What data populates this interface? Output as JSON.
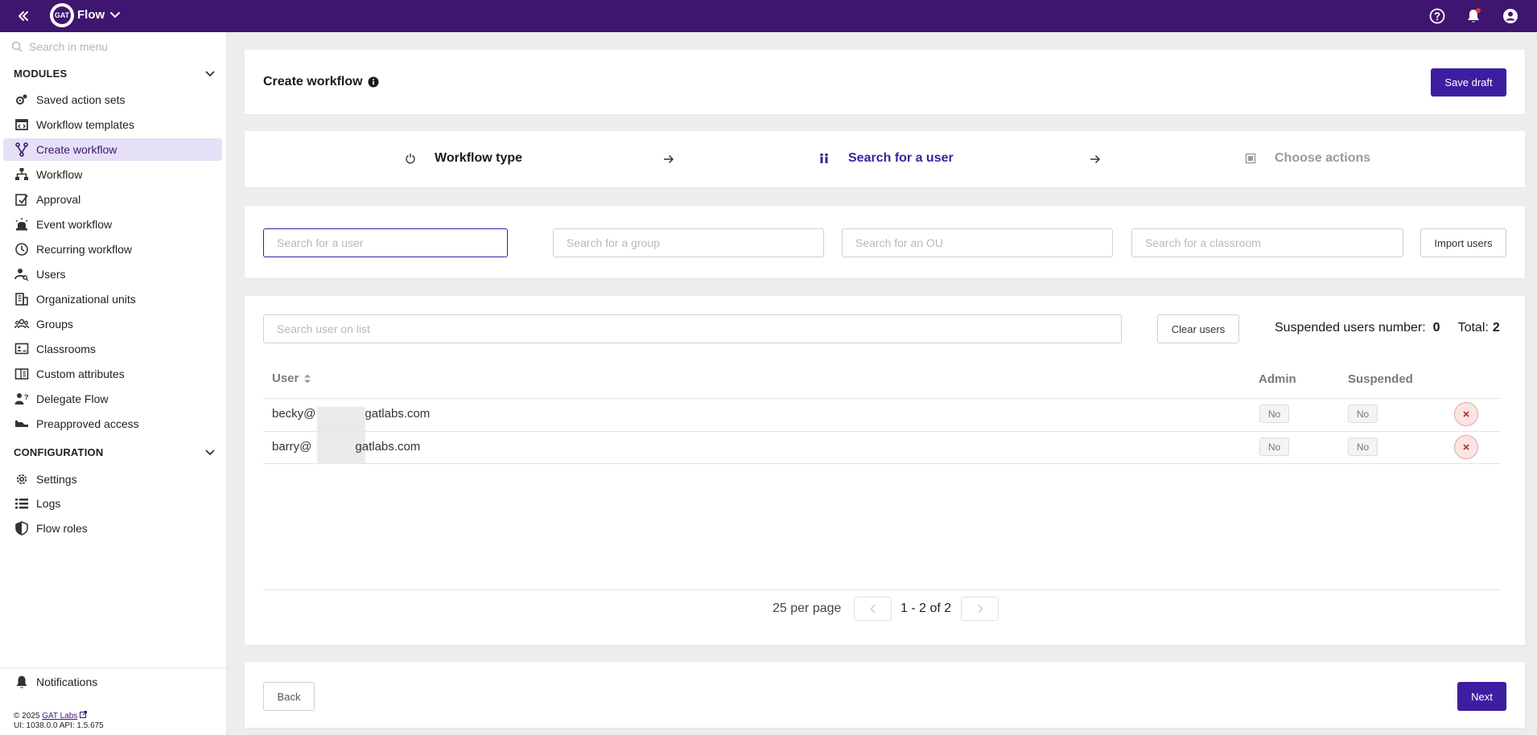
{
  "topbar": {
    "app_logo_text": "GAT",
    "app_name": "Flow"
  },
  "sidebar": {
    "search_placeholder": "Search in menu",
    "modules_title": "MODULES",
    "modules": [
      {
        "label": "Saved action sets",
        "icon": "gears-icon"
      },
      {
        "label": "Workflow templates",
        "icon": "template-icon"
      },
      {
        "label": "Create workflow",
        "icon": "fork-icon",
        "active": true
      },
      {
        "label": "Workflow",
        "icon": "hierarchy-icon"
      },
      {
        "label": "Approval",
        "icon": "approval-icon"
      },
      {
        "label": "Event workflow",
        "icon": "siren-icon"
      },
      {
        "label": "Recurring workflow",
        "icon": "clock-icon"
      },
      {
        "label": "Users",
        "icon": "user-search-icon"
      },
      {
        "label": "Organizational units",
        "icon": "building-icon"
      },
      {
        "label": "Groups",
        "icon": "groups-icon"
      },
      {
        "label": "Classrooms",
        "icon": "classroom-icon"
      },
      {
        "label": "Custom attributes",
        "icon": "attributes-icon"
      },
      {
        "label": "Delegate Flow",
        "icon": "delegate-icon"
      },
      {
        "label": "Preapproved access",
        "icon": "preapproved-icon"
      }
    ],
    "config_title": "CONFIGURATION",
    "config": [
      {
        "label": "Settings",
        "icon": "gear-icon"
      },
      {
        "label": "Logs",
        "icon": "list-icon"
      },
      {
        "label": "Flow roles",
        "icon": "shield-icon"
      }
    ],
    "notifications_label": "Notifications",
    "footer_copyright": "© 2025",
    "footer_link": "GAT Labs",
    "footer_version": "UI: 1038.0.0 API: 1.5.675"
  },
  "header": {
    "title": "Create workflow",
    "save_draft": "Save draft"
  },
  "steps": [
    {
      "label": "Workflow type",
      "state": "done"
    },
    {
      "label": "Search for a user",
      "state": "active"
    },
    {
      "label": "Choose actions",
      "state": "inactive"
    }
  ],
  "search": {
    "user_placeholder": "Search for a user",
    "group_placeholder": "Search for a group",
    "ou_placeholder": "Search for an OU",
    "classroom_placeholder": "Search for a classroom",
    "import_users": "Import users"
  },
  "list": {
    "search_placeholder": "Search user on list",
    "clear_users": "Clear users",
    "suspended_label": "Suspended users number:",
    "suspended_count": "0",
    "total_label": "Total:",
    "total_count": "2",
    "columns": {
      "user": "User",
      "admin": "Admin",
      "suspended": "Suspended"
    },
    "rows": [
      {
        "email": "becky@gatlabs.com",
        "email_visible_prefix": "becky@",
        "email_visible_suffix": "gatlabs.com",
        "admin": "No",
        "suspended": "No"
      },
      {
        "email": "barry@gatlabs.com",
        "email_visible_prefix": "barry@",
        "email_visible_suffix": "gatlabs.com",
        "admin": "No",
        "suspended": "No"
      }
    ],
    "per_page": "25 per page",
    "range": "1 - 2 of 2"
  },
  "footer_nav": {
    "back": "Back",
    "next": "Next"
  },
  "colors": {
    "topbar": "#3e1670",
    "primary_button": "#3e1ea0",
    "active_step": "#3e1ea0",
    "active_nav_bg": "#e5e0f7"
  }
}
